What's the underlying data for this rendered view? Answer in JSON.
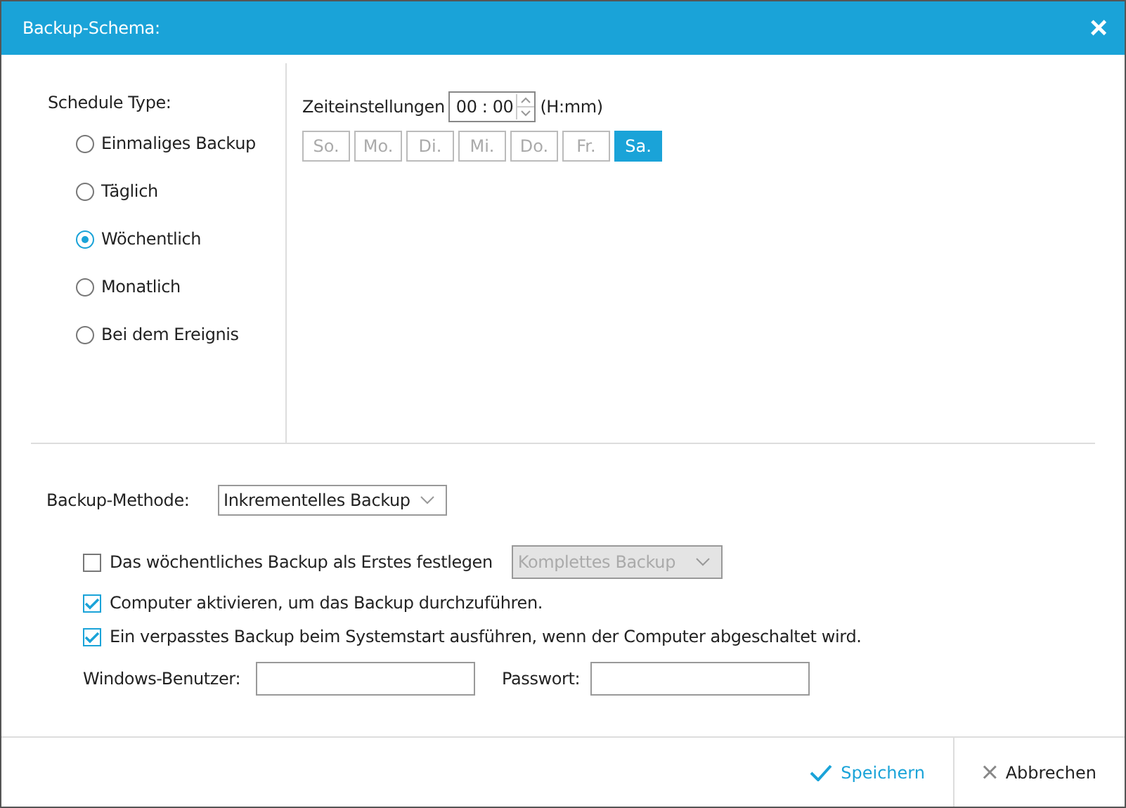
{
  "window": {
    "title": "Backup-Schema:",
    "close": "×"
  },
  "schedule": {
    "label": "Schedule Type:",
    "options": [
      {
        "label": "Einmaliges Backup",
        "selected": false
      },
      {
        "label": "Täglich",
        "selected": false
      },
      {
        "label": "Wöchentlich",
        "selected": true
      },
      {
        "label": "Monatlich",
        "selected": false
      },
      {
        "label": "Bei dem Ereignis",
        "selected": false
      }
    ]
  },
  "time": {
    "label": "Zeiteinstellungen",
    "value": "00 : 00",
    "format": "(H:mm)"
  },
  "days": [
    {
      "label": "So.",
      "selected": false
    },
    {
      "label": "Mo.",
      "selected": false
    },
    {
      "label": "Di.",
      "selected": false
    },
    {
      "label": "Mi.",
      "selected": false
    },
    {
      "label": "Do.",
      "selected": false
    },
    {
      "label": "Fr.",
      "selected": false
    },
    {
      "label": "Sa.",
      "selected": true
    }
  ],
  "method": {
    "label": "Backup-Methode:",
    "value": "Inkrementelles Backup"
  },
  "options": [
    {
      "label": "Das wöchentliches Backup als Erstes festlegen",
      "checked": false,
      "dropdown": {
        "value": "Komplettes Backup",
        "disabled": true
      }
    },
    {
      "label": "Computer aktivieren, um das Backup durchzuführen.",
      "checked": true
    },
    {
      "label": "Ein verpasstes Backup beim Systemstart ausführen, wenn der Computer abgeschaltet wird.",
      "checked": true
    }
  ],
  "credentials": [
    {
      "label": "Windows-Benutzer:"
    },
    {
      "label": "Passwort:"
    }
  ],
  "buttons": [
    {
      "label": "Speichern",
      "kind": "save"
    },
    {
      "label": "Abbrechen",
      "kind": "cancel"
    }
  ]
}
